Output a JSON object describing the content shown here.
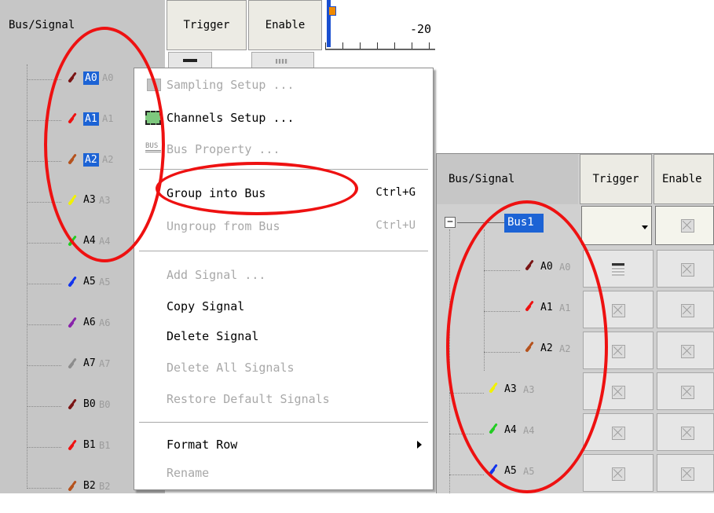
{
  "left": {
    "header": {
      "bus_signal": "Bus/Signal",
      "trigger": "Trigger",
      "enable": "Enable",
      "timeline": "-20"
    },
    "signals": [
      {
        "name": "A0",
        "ghost": "A0",
        "color": "#7a1515",
        "selected": true
      },
      {
        "name": "A1",
        "ghost": "A1",
        "color": "#ee1111",
        "selected": true
      },
      {
        "name": "A2",
        "ghost": "A2",
        "color": "#b5521d",
        "selected": true
      },
      {
        "name": "A3",
        "ghost": "A3",
        "color": "#f2f200",
        "selected": false
      },
      {
        "name": "A4",
        "ghost": "A4",
        "color": "#22cc22",
        "selected": false
      },
      {
        "name": "A5",
        "ghost": "A5",
        "color": "#1133ee",
        "selected": false
      },
      {
        "name": "A6",
        "ghost": "A6",
        "color": "#8822aa",
        "selected": false
      },
      {
        "name": "A7",
        "ghost": "A7",
        "color": "#8c8c8c",
        "selected": false
      },
      {
        "name": "B0",
        "ghost": "B0",
        "color": "#7a1515",
        "selected": false
      },
      {
        "name": "B1",
        "ghost": "B1",
        "color": "#ee1111",
        "selected": false
      },
      {
        "name": "B2",
        "ghost": "B2",
        "color": "#b5521d",
        "selected": false
      }
    ]
  },
  "menu": {
    "items": [
      {
        "label": "Sampling Setup ...",
        "shortcut": "",
        "disabled": true,
        "icon": "sampling-icon"
      },
      {
        "label": "Channels Setup ...",
        "shortcut": "",
        "disabled": false,
        "icon": "channels-icon"
      },
      {
        "label": "Bus Property ...",
        "shortcut": "",
        "disabled": true,
        "icon": "bus-icon"
      },
      {
        "label": "Group into Bus",
        "shortcut": "Ctrl+G",
        "disabled": false
      },
      {
        "label": "Ungroup from Bus",
        "shortcut": "Ctrl+U",
        "disabled": true
      },
      {
        "label": "Add Signal ...",
        "shortcut": "",
        "disabled": true
      },
      {
        "label": "Copy Signal",
        "shortcut": "",
        "disabled": false
      },
      {
        "label": "Delete Signal",
        "shortcut": "",
        "disabled": false
      },
      {
        "label": "Delete All Signals",
        "shortcut": "",
        "disabled": true
      },
      {
        "label": "Restore Default Signals",
        "shortcut": "",
        "disabled": true
      },
      {
        "label": "Format Row",
        "shortcut": "",
        "disabled": false,
        "submenu": true
      },
      {
        "label": "Rename",
        "shortcut": "",
        "disabled": true
      }
    ],
    "bus_icon_text": "BUS"
  },
  "right": {
    "header": {
      "bus_signal": "Bus/Signal",
      "trigger": "Trigger",
      "enable": "Enable"
    },
    "bus": {
      "label": "Bus1",
      "collapse_glyph": "−"
    },
    "children": [
      {
        "name": "A0",
        "ghost": "A0",
        "color": "#7a1515"
      },
      {
        "name": "A1",
        "ghost": "A1",
        "color": "#ee1111"
      },
      {
        "name": "A2",
        "ghost": "A2",
        "color": "#b5521d"
      }
    ],
    "signals": [
      {
        "name": "A3",
        "ghost": "A3",
        "color": "#f2f200"
      },
      {
        "name": "A4",
        "ghost": "A4",
        "color": "#22cc22"
      },
      {
        "name": "A5",
        "ghost": "A5",
        "color": "#1133ee"
      }
    ]
  },
  "accent": "#1c63d5",
  "highlight_color": "#ee1111"
}
